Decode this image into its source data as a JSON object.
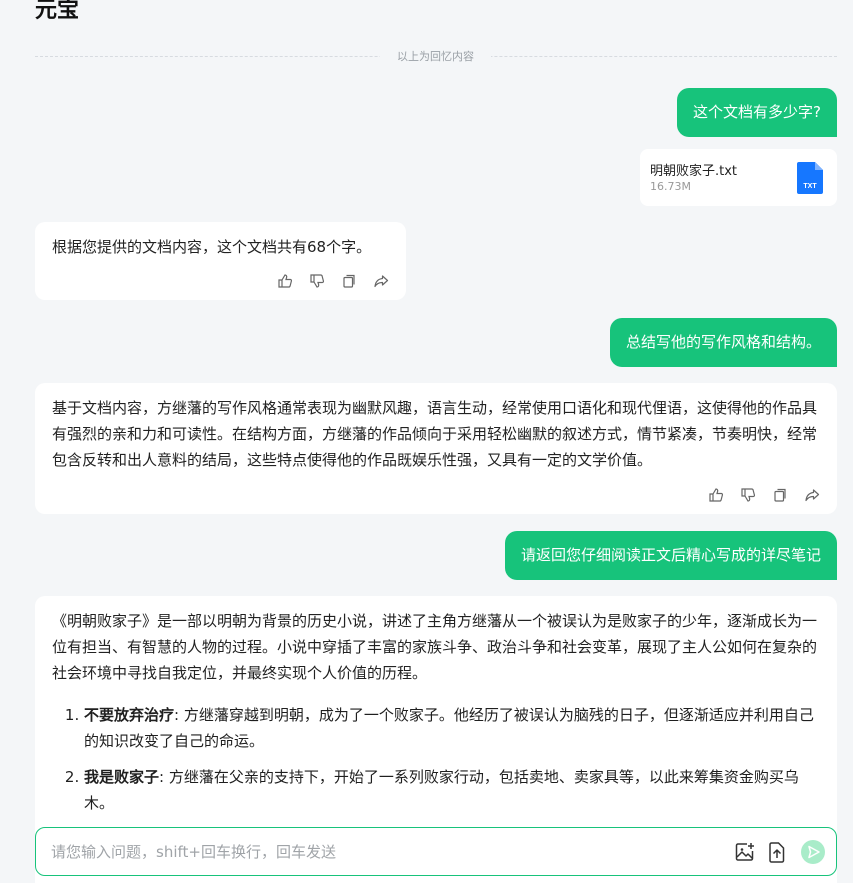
{
  "app": {
    "title": "元宝"
  },
  "history_divider": "以上为回忆内容",
  "messages": {
    "user1": "这个文档有多少字?",
    "file": {
      "name": "明朝败家子.txt",
      "size": "16.73M",
      "type_label": "TXT"
    },
    "bot1": "根据您提供的文档内容，这个文档共有68个字。",
    "user2": "总结写他的写作风格和结构。",
    "bot2": "基于文档内容，方继藩的写作风格通常表现为幽默风趣，语言生动，经常使用口语化和现代俚语，这使得他的作品具有强烈的亲和力和可读性。在结构方面，方继藩的作品倾向于采用轻松幽默的叙述方式，情节紧凑，节奏明快，经常包含反转和出人意料的结局，这些特点使得他的作品既娱乐性强，又具有一定的文学价值。",
    "user3": "请返回您仔细阅读正文后精心写成的详尽笔记",
    "bot3": {
      "intro": "《明朝败家子》是一部以明朝为背景的历史小说，讲述了主角方继藩从一个被误认为是败家子的少年，逐渐成长为一位有担当、有智慧的人物的过程。小说中穿插了丰富的家族斗争、政治斗争和社会变革，展现了主人公如何在复杂的社会环境中寻找自我定位，并最终实现个人价值的历程。",
      "points": [
        {
          "title": "不要放弃治疗",
          "text": ": 方继藩穿越到明朝，成为了一个败家子。他经历了被误认为脑残的日子，但逐渐适应并利用自己的知识改变了自己的命运。"
        },
        {
          "title": "我是败家子",
          "text": ": 方继藩在父亲的支持下，开始了一系列败家行动，包括卖地、卖家具等，以此来筹集资金购买乌木。"
        }
      ]
    }
  },
  "message_actions": [
    "like-icon",
    "dislike-icon",
    "copy-icon",
    "share-icon"
  ],
  "input": {
    "placeholder": "请您输入问题，shift+回车换行，回车发送",
    "value": ""
  },
  "colors": {
    "accent": "#17c37b",
    "send_disabled": "#a9ecc9",
    "file_icon": "#1677ff"
  }
}
